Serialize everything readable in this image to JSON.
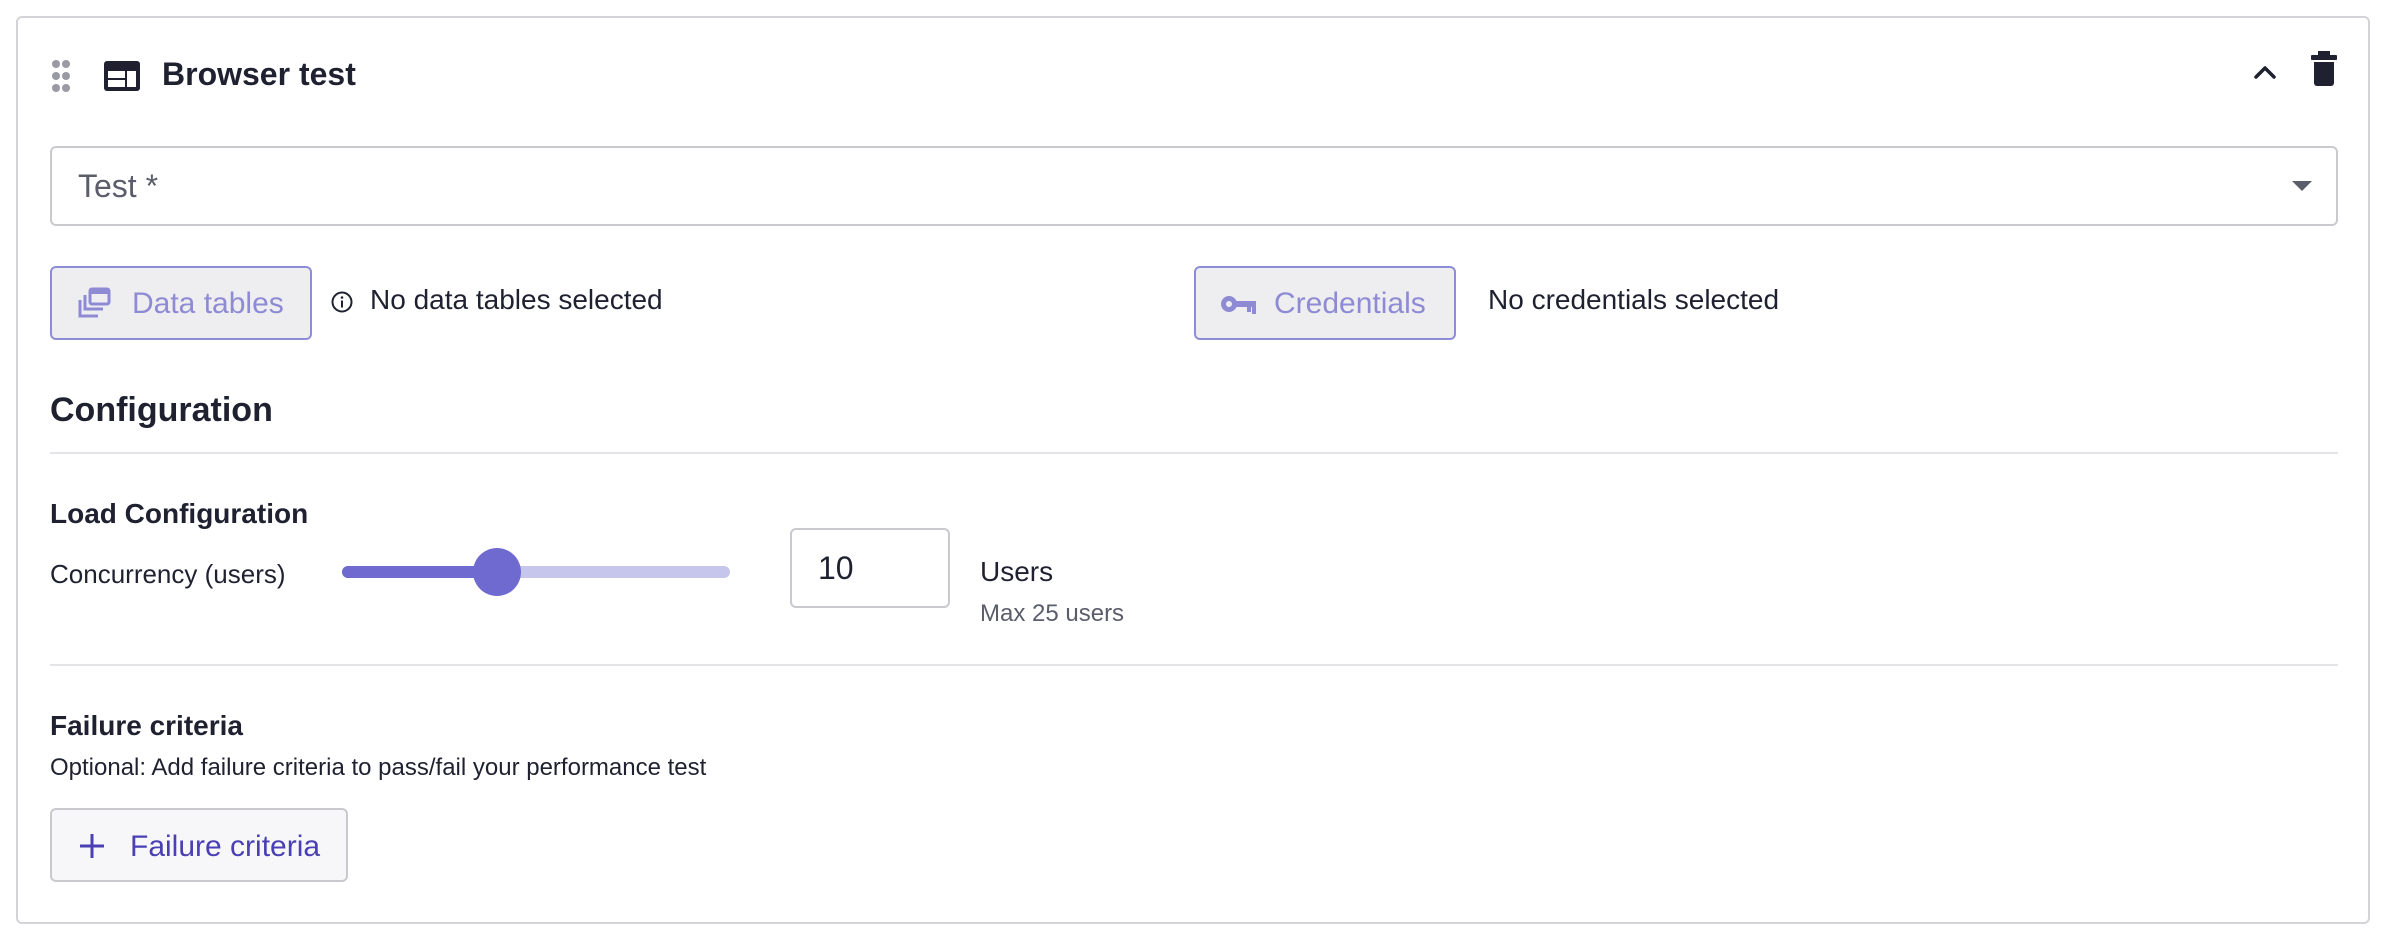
{
  "header": {
    "title": "Browser test",
    "icons": [
      "drag-handle-icon",
      "browser-window-icon",
      "chevron-up-icon",
      "trash-icon"
    ]
  },
  "test_select": {
    "label": "Test *"
  },
  "data_tables": {
    "button_label": "Data tables",
    "status": "No data tables selected"
  },
  "credentials": {
    "button_label": "Credentials",
    "status": "No credentials selected"
  },
  "configuration": {
    "title": "Configuration",
    "load": {
      "title": "Load Configuration",
      "concurrency_label": "Concurrency (users)",
      "value": "10",
      "max": 25,
      "unit_label": "Users",
      "max_label": "Max 25 users"
    }
  },
  "failure": {
    "title": "Failure criteria",
    "description": "Optional: Add failure criteria to pass/fail your performance test",
    "add_button_label": "Failure criteria"
  },
  "colors": {
    "accent": "#6e6ad0",
    "accent_light": "#c6c5ec",
    "button_text": "#4a3fb3",
    "border": "#c9c9ce"
  }
}
